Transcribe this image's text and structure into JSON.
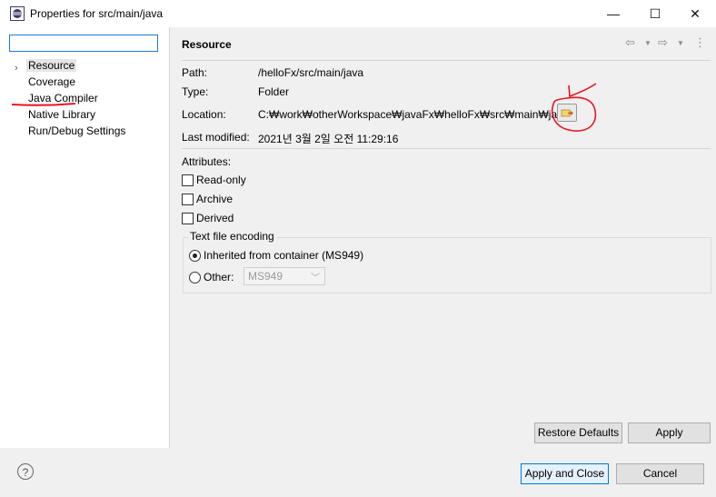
{
  "window": {
    "title": "Properties for src/main/java",
    "minimize_glyph": "—",
    "maximize_glyph": "☐",
    "close_glyph": "✕"
  },
  "sidebar": {
    "filter_value": "",
    "items": [
      {
        "label": "Resource",
        "selected": true,
        "expandable": true
      },
      {
        "label": "Coverage"
      },
      {
        "label": "Java Compiler"
      },
      {
        "label": "Native Library"
      },
      {
        "label": "Run/Debug Settings"
      }
    ]
  },
  "page": {
    "title": "Resource",
    "path_label": "Path:",
    "path_value": "/helloFx/src/main/java",
    "type_label": "Type:",
    "type_value": "Folder",
    "location_label": "Location:",
    "location_value": "C:₩work₩otherWorkspace₩javaFx₩helloFx₩src₩main₩java",
    "modified_label": "Last modified:",
    "modified_value": "2021년 3월 2일 오전 11:29:16",
    "attributes_label": "Attributes:",
    "checkboxes": [
      {
        "label": "Read-only",
        "checked": false
      },
      {
        "label": "Archive",
        "checked": false
      },
      {
        "label": "Derived",
        "checked": false
      }
    ],
    "encoding_group": "Text file encoding",
    "encoding_inherited": "Inherited from container (MS949)",
    "encoding_other": "Other:",
    "encoding_other_value": "MS949",
    "restore_defaults": "Restore Defaults",
    "apply": "Apply"
  },
  "footer": {
    "help": "?",
    "apply_close": "Apply and Close",
    "cancel": "Cancel"
  },
  "colors": {
    "annotation": "#e8141f",
    "focus": "#0078d7"
  }
}
